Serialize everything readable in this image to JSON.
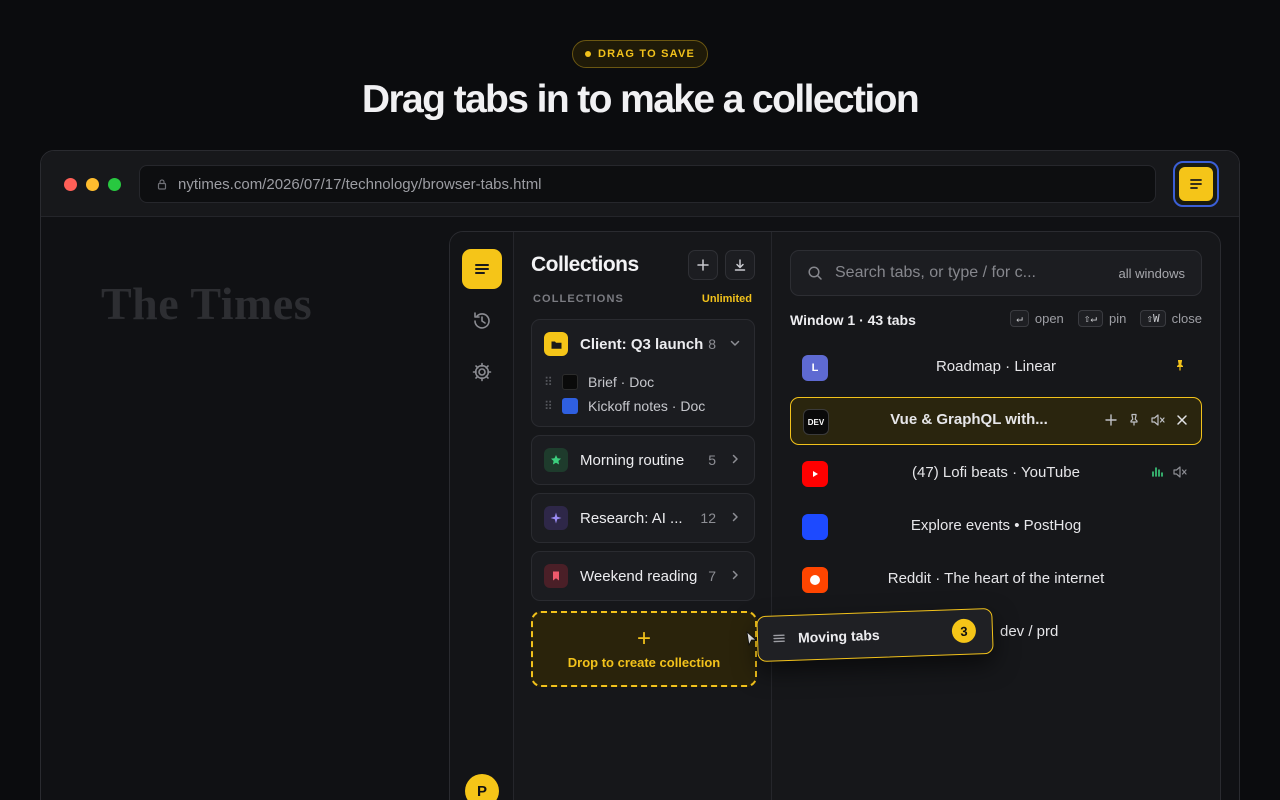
{
  "hero": {
    "badge": "DRAG TO SAVE",
    "title": "Drag tabs in to make a collection"
  },
  "browser": {
    "url": "nytimes.com/2026/07/17/technology/browser-tabs.html",
    "page_logo": "The Times"
  },
  "rail": {
    "avatar_initial": "P"
  },
  "collections": {
    "title": "Collections",
    "section_label": "COLLECTIONS",
    "plan": "Unlimited",
    "items": [
      {
        "name": "Client: Q3 launch",
        "count": "8",
        "icon": "folder-icon",
        "color": "#f5c518",
        "expanded": true,
        "children": [
          {
            "title": "Brief · Doc",
            "color": "#0a0a0a"
          },
          {
            "title": "Kickoff notes · Doc",
            "color": "#2f5fe0"
          }
        ]
      },
      {
        "name": "Morning routine",
        "count": "5",
        "icon": "star-icon",
        "color": "#1e3b2c"
      },
      {
        "name": "Research: AI ...",
        "count": "12",
        "icon": "sparkle-icon",
        "color": "#2e2748"
      },
      {
        "name": "Weekend reading",
        "count": "7",
        "icon": "bookmark-icon",
        "color": "#4a1f27"
      }
    ],
    "dropzone_label": "Drop to create collection"
  },
  "tabs": {
    "search_placeholder": "Search tabs, or type / for c...",
    "search_scope": "all windows",
    "window_label": "Window 1 · 43 tabs",
    "hints": [
      {
        "key": "↵",
        "label": "open"
      },
      {
        "key": "⇧↵",
        "label": "pin"
      },
      {
        "key": "⇧W",
        "label": "close"
      }
    ],
    "items": [
      {
        "title": "Roadmap · Linear",
        "favicon_text": "L",
        "favicon_color": "#5e6ad2"
      },
      {
        "title": "Vue & GraphQL with...",
        "favicon_text": "DEV",
        "favicon_color": "#0a0a0a"
      },
      {
        "title": "(47) Lofi beats · YouTube",
        "favicon_text": "",
        "favicon_color": "#ff0000"
      },
      {
        "title": "Explore events • PostHog",
        "favicon_text": "",
        "favicon_color": "#1d4aff"
      },
      {
        "title": "Reddit · The heart of the internet",
        "favicon_text": "",
        "favicon_color": "#ff4500"
      },
      {
        "title": "dev / prd",
        "favicon_text": "",
        "favicon_color": "#2b2c31"
      }
    ]
  },
  "drag": {
    "label": "Moving tabs",
    "count": "3"
  },
  "colors": {
    "accent": "#f5c518",
    "background": "#0b0c0e",
    "panel": "#16171a"
  }
}
